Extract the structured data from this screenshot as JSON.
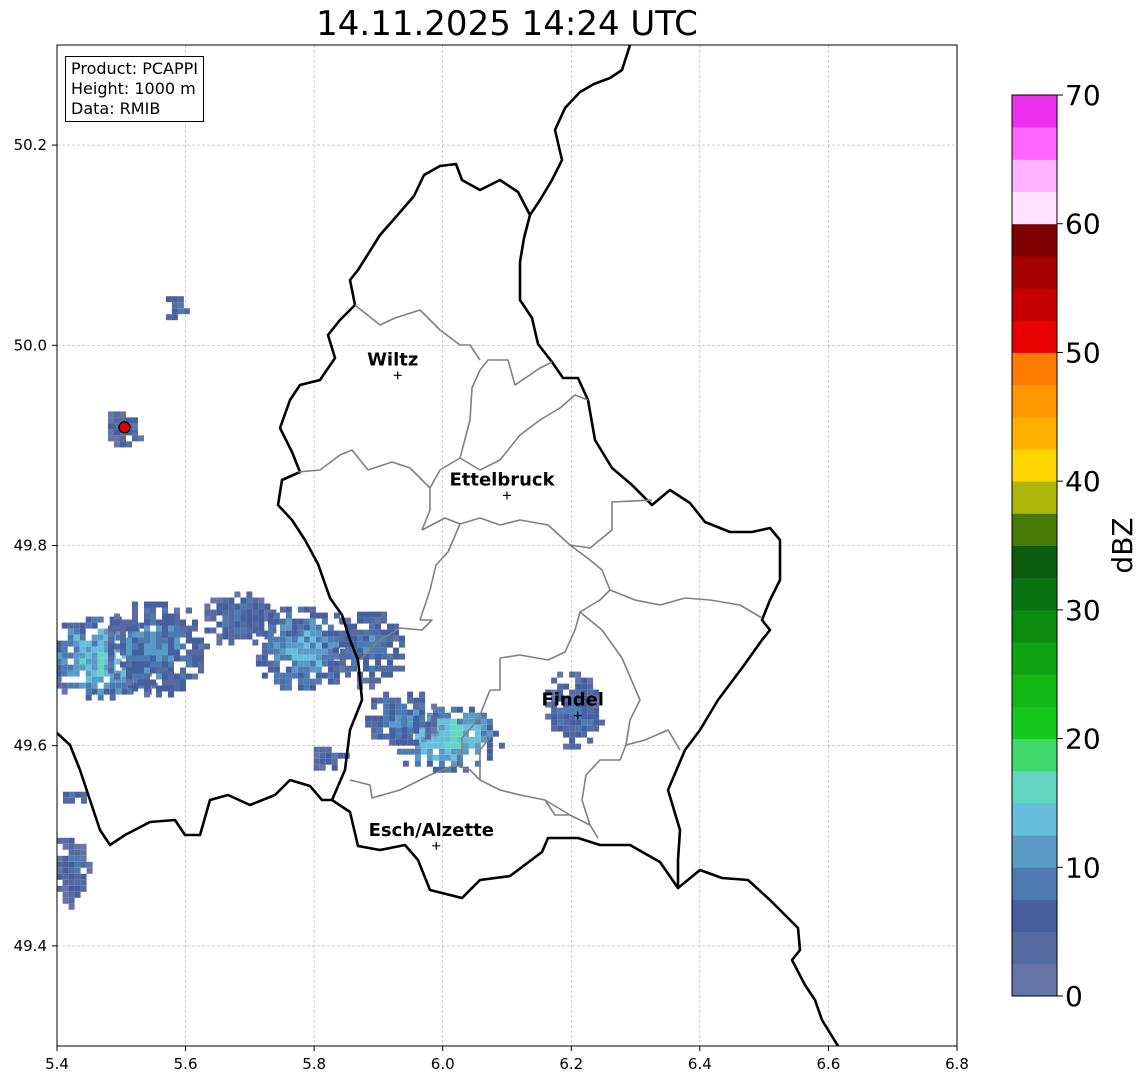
{
  "title": "14.11.2025 14:24 UTC",
  "info": {
    "product": "Product: PCAPPI",
    "height": "Height: 1000 m",
    "data": "Data: RMIB"
  },
  "map_data": {
    "lon_range": [
      5.4,
      6.8
    ],
    "lat_range": [
      49.3,
      50.3
    ],
    "x_ticks": [
      "5.4",
      "5.6",
      "5.8",
      "6.0",
      "6.2",
      "6.4",
      "6.6",
      "6.8"
    ],
    "x_tick_values": [
      5.4,
      5.6,
      5.8,
      6.0,
      6.2,
      6.4,
      6.6,
      6.8
    ],
    "y_ticks": [
      "49.4",
      "49.6",
      "49.8",
      "50.0",
      "50.2"
    ],
    "y_tick_values": [
      49.4,
      49.6,
      49.8,
      50.0,
      50.2
    ],
    "grid": true,
    "cities": [
      {
        "name": "Wiltz",
        "lon": 5.93,
        "lat": 49.97
      },
      {
        "name": "Ettelbruck",
        "lon": 6.1,
        "lat": 49.85
      },
      {
        "name": "Findel",
        "lon": 6.21,
        "lat": 49.63
      },
      {
        "name": "Esch/Alzette",
        "lon": 5.99,
        "lat": 49.5
      }
    ],
    "radar_site": {
      "lon": 5.505,
      "lat": 49.918,
      "color": "#e00000"
    },
    "echo_areas": [
      {
        "lon": 5.47,
        "lat": 49.69,
        "rlon": 0.1,
        "rlat": 0.045,
        "dbz": 12
      },
      {
        "lon": 5.55,
        "lat": 49.7,
        "rlon": 0.08,
        "rlat": 0.05,
        "dbz": 8
      },
      {
        "lon": 5.68,
        "lat": 49.73,
        "rlon": 0.06,
        "rlat": 0.03,
        "dbz": 6
      },
      {
        "lon": 5.78,
        "lat": 49.7,
        "rlon": 0.08,
        "rlat": 0.045,
        "dbz": 10
      },
      {
        "lon": 5.88,
        "lat": 49.7,
        "rlon": 0.06,
        "rlat": 0.04,
        "dbz": 7
      },
      {
        "lon": 6.0,
        "lat": 49.61,
        "rlon": 0.09,
        "rlat": 0.035,
        "dbz": 13
      },
      {
        "lon": 5.93,
        "lat": 49.63,
        "rlon": 0.06,
        "rlat": 0.03,
        "dbz": 8
      },
      {
        "lon": 5.82,
        "lat": 49.59,
        "rlon": 0.03,
        "rlat": 0.015,
        "dbz": 6
      },
      {
        "lon": 6.2,
        "lat": 49.64,
        "rlon": 0.05,
        "rlat": 0.04,
        "dbz": 6
      },
      {
        "lon": 5.42,
        "lat": 49.48,
        "rlon": 0.03,
        "rlat": 0.04,
        "dbz": 5
      },
      {
        "lon": 5.42,
        "lat": 49.55,
        "rlon": 0.02,
        "rlat": 0.01,
        "dbz": 5
      },
      {
        "lon": 5.5,
        "lat": 49.92,
        "rlon": 0.03,
        "rlat": 0.02,
        "dbz": 4
      },
      {
        "lon": 5.58,
        "lat": 50.04,
        "rlon": 0.02,
        "rlat": 0.015,
        "dbz": 6
      }
    ]
  },
  "colorbar": {
    "label": "dBZ",
    "ticks": [
      "0",
      "10",
      "20",
      "30",
      "40",
      "50",
      "60",
      "70"
    ],
    "tick_values": [
      0,
      10,
      20,
      30,
      40,
      50,
      60,
      70
    ],
    "range": [
      0,
      70
    ],
    "step": 2.5,
    "colors": [
      "#6674a8",
      "#566aa2",
      "#455f9f",
      "#4d7ab0",
      "#5a9bc6",
      "#66c0dd",
      "#62d6c0",
      "#3ed86b",
      "#14c91c",
      "#12b815",
      "#0fa211",
      "#0b8a0d",
      "#097312",
      "#0c5c0d",
      "#4a7a06",
      "#acb50a",
      "#ffd500",
      "#ffb000",
      "#ff9800",
      "#ff7a00",
      "#e80000",
      "#c40000",
      "#a40000",
      "#7e0000",
      "#ffe2ff",
      "#ffb2ff",
      "#ff66ff",
      "#ee30ee"
    ]
  }
}
